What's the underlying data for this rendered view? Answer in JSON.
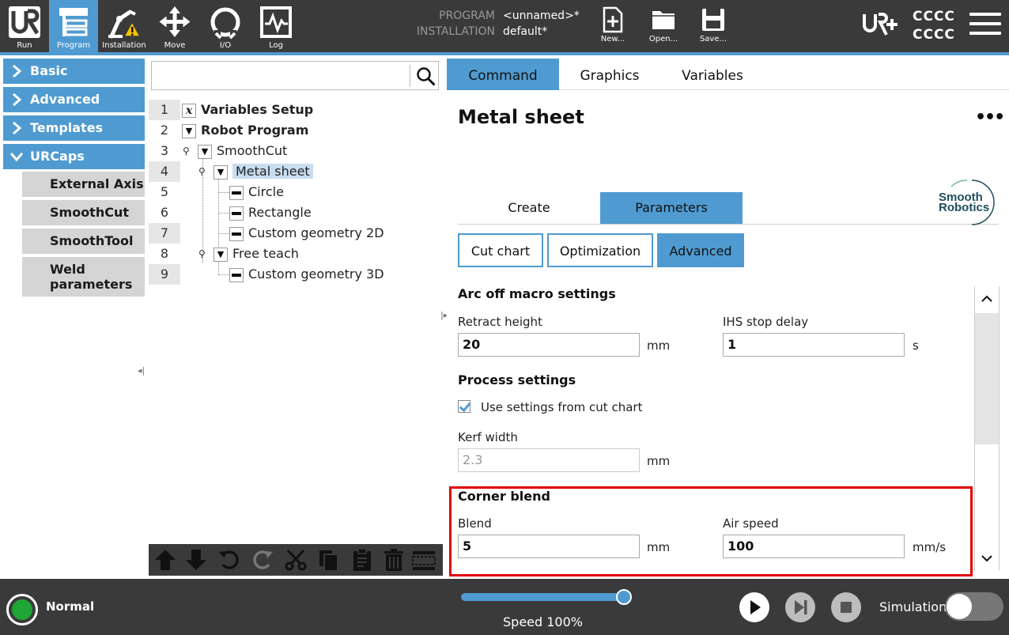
{
  "header": {
    "nav": [
      {
        "label": "Run",
        "icon": "ur-logo-icon"
      },
      {
        "label": "Program",
        "icon": "program-tree-icon",
        "active": true
      },
      {
        "label": "Installation",
        "icon": "robot-arm-warning-icon"
      },
      {
        "label": "Move",
        "icon": "move-arrows-icon"
      },
      {
        "label": "I/O",
        "icon": "io-icon"
      },
      {
        "label": "Log",
        "icon": "log-chart-icon"
      }
    ],
    "program_key": "PROGRAM",
    "program_value": "<unnamed>*",
    "installation_key": "INSTALLATION",
    "installation_value": "default*",
    "file_buttons": [
      {
        "label": "New...",
        "icon": "new-file-icon"
      },
      {
        "label": "Open...",
        "icon": "open-folder-icon"
      },
      {
        "label": "Save...",
        "icon": "save-disk-icon"
      }
    ],
    "user_line1": "CCCC",
    "user_line2": "CCCC",
    "accent": "#4f9bd1"
  },
  "sidebar": {
    "categories": [
      {
        "label": "Basic",
        "expanded": false
      },
      {
        "label": "Advanced",
        "expanded": false
      },
      {
        "label": "Templates",
        "expanded": false
      },
      {
        "label": "URCaps",
        "expanded": true
      }
    ],
    "urcaps_items": [
      "External Axis",
      "SmoothCut",
      "SmoothTool",
      "Weld parameters"
    ]
  },
  "tree": {
    "search_placeholder": "",
    "rows": [
      {
        "num": "1",
        "label": "Variables Setup"
      },
      {
        "num": "2",
        "label": "Robot Program"
      },
      {
        "num": "3",
        "label": "SmoothCut"
      },
      {
        "num": "4",
        "label": "Metal sheet"
      },
      {
        "num": "5",
        "label": "Circle"
      },
      {
        "num": "6",
        "label": "Rectangle"
      },
      {
        "num": "7",
        "label": "Custom geometry 2D"
      },
      {
        "num": "8",
        "label": "Free teach"
      },
      {
        "num": "9",
        "label": "Custom geometry 3D"
      }
    ]
  },
  "right": {
    "tabs": [
      "Command",
      "Graphics",
      "Variables"
    ],
    "active_tab": "Command",
    "node_title": "Metal sheet",
    "more": "•••",
    "subtabs": [
      "Create",
      "Parameters"
    ],
    "active_subtab": "Parameters",
    "logo_line1": "Smooth",
    "logo_line2": "Robotics",
    "option_buttons": [
      "Cut chart",
      "Optimization",
      "Advanced"
    ],
    "active_option": "Advanced",
    "arc_off": {
      "title": "Arc off macro settings",
      "retract_label": "Retract height",
      "retract_value": "20",
      "retract_unit": "mm",
      "ihs_label": "IHS stop delay",
      "ihs_value": "1",
      "ihs_unit": "s"
    },
    "process": {
      "title": "Process settings",
      "use_cut_chart_label": "Use settings from cut chart",
      "use_cut_chart_checked": true,
      "kerf_label": "Kerf width",
      "kerf_value": "2.3",
      "kerf_unit": "mm"
    },
    "corner_blend": {
      "title": "Corner blend",
      "blend_label": "Blend",
      "blend_value": "5",
      "blend_unit": "mm",
      "air_speed_label": "Air speed",
      "air_speed_value": "100",
      "air_speed_unit": "mm/s"
    }
  },
  "footer": {
    "status": "Normal",
    "status_color": "#1fa634",
    "speed_text": "Speed 100%",
    "speed_fraction": 1.0,
    "simulation_label": "Simulation",
    "simulation_on": false
  }
}
